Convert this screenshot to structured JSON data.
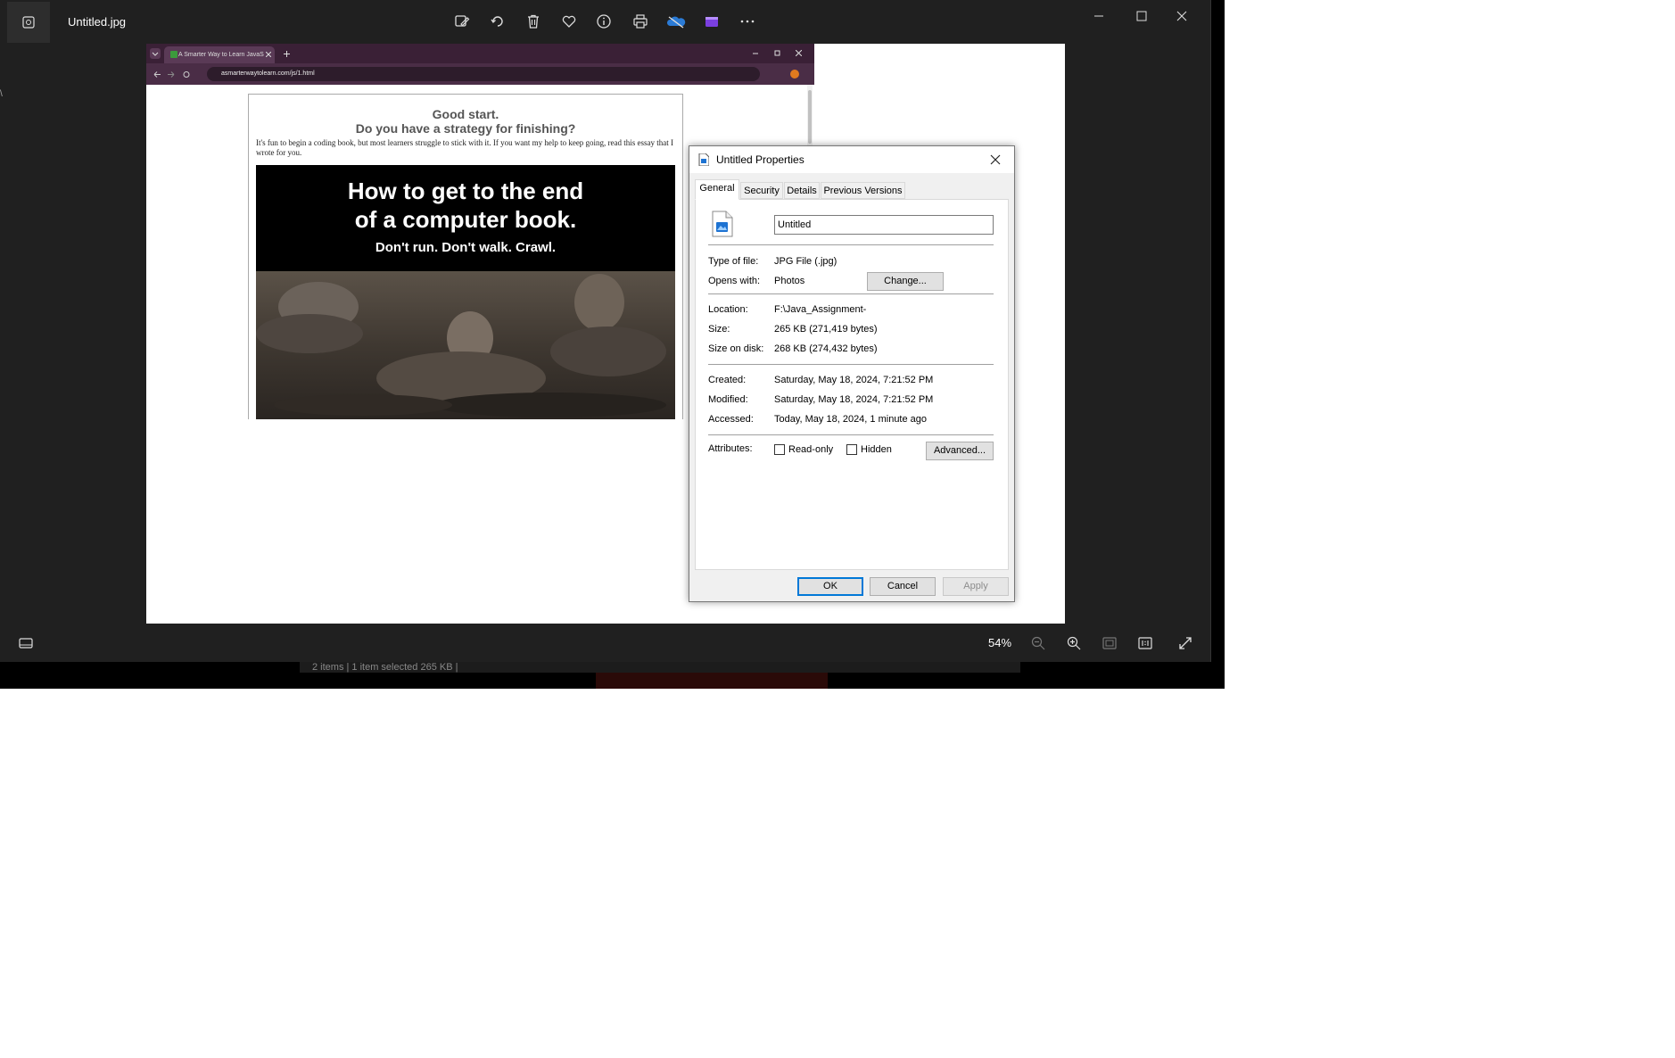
{
  "viewer": {
    "file_title": "Untitled.jpg",
    "zoom": "54%",
    "explorer_status": "2 items  |  1 item selected  265 KB  |",
    "side_text": "\\",
    "toolbar_icons": [
      "edit-icon",
      "rotate-icon",
      "delete-icon",
      "favorite-icon",
      "info-icon",
      "print-icon",
      "onedrive-icon",
      "clipchamp-icon",
      "more-icon"
    ],
    "bottom_icons": [
      "filmstrip-icon",
      "zoom-out-icon",
      "zoom-in-icon",
      "fit-icon",
      "actual-size-icon",
      "fullscreen-icon"
    ]
  },
  "image_content": {
    "browser": {
      "tab_title": "A Smarter Way to Learn JavaS",
      "url": "asmarterwaytolearn.com/js/1.html"
    },
    "article": {
      "heading1": "Good start.",
      "heading2": "Do you have a strategy for finishing?",
      "body": "It's fun to begin a coding book, but most learners struggle to stick with it. If you want my help to keep going, read this essay that I wrote for you.",
      "promo_line1": "How to get to the end",
      "promo_line2": "of a computer book.",
      "promo_line3": "Don't run. Don't walk. Crawl."
    }
  },
  "dialog": {
    "title": "Untitled Properties",
    "tabs": [
      "General",
      "Security",
      "Details",
      "Previous Versions"
    ],
    "active_tab": "General",
    "file_name": "Untitled",
    "labels": {
      "type": "Type of file:",
      "opens": "Opens with:",
      "location": "Location:",
      "size": "Size:",
      "size_on_disk": "Size on disk:",
      "created": "Created:",
      "modified": "Modified:",
      "accessed": "Accessed:",
      "attributes": "Attributes:"
    },
    "values": {
      "type": "JPG File (.jpg)",
      "opens": "Photos",
      "location": "F:\\Java_Assignment-",
      "size": "265 KB (271,419 bytes)",
      "size_on_disk": "268 KB (274,432 bytes)",
      "created": "Saturday, May 18, 2024, 7:21:52 PM",
      "modified": "Saturday, May 18, 2024, 7:21:52 PM",
      "accessed": "Today, May 18, 2024, 1 minute ago"
    },
    "checkboxes": {
      "readonly": "Read-only",
      "hidden": "Hidden",
      "readonly_checked": false,
      "hidden_checked": false
    },
    "buttons": {
      "change": "Change...",
      "advanced": "Advanced...",
      "ok": "OK",
      "cancel": "Cancel",
      "apply": "Apply"
    }
  }
}
